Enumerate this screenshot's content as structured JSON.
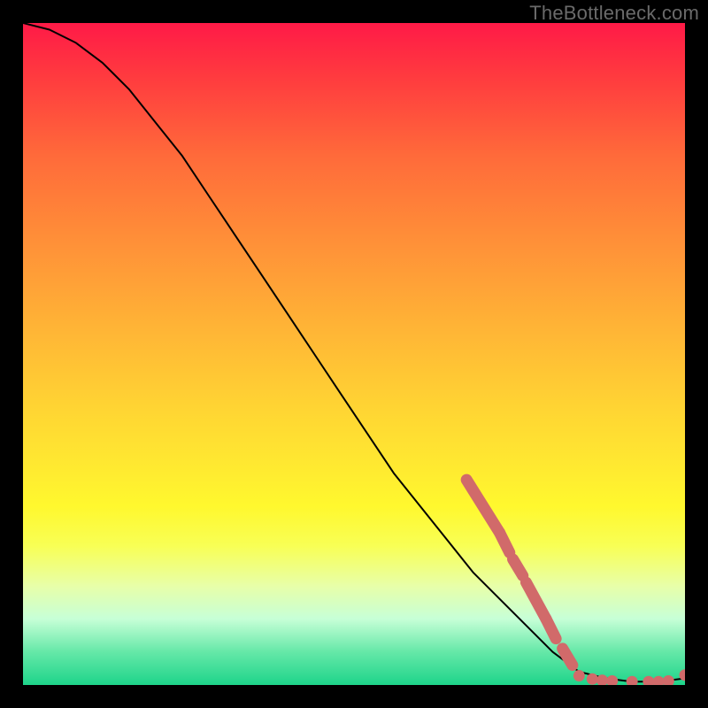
{
  "watermark": "TheBottleneck.com",
  "chart_data": {
    "type": "line",
    "title": "",
    "xlabel": "",
    "ylabel": "",
    "xlim": [
      0,
      100
    ],
    "ylim": [
      0,
      100
    ],
    "series": [
      {
        "name": "curve",
        "x": [
          0,
          4,
          8,
          12,
          16,
          20,
          24,
          28,
          32,
          36,
          40,
          44,
          48,
          52,
          56,
          60,
          64,
          68,
          72,
          76,
          80,
          84,
          88,
          92,
          96,
          100
        ],
        "y": [
          100,
          99,
          97,
          94,
          90,
          85,
          80,
          74,
          68,
          62,
          56,
          50,
          44,
          38,
          32,
          27,
          22,
          17,
          13,
          9,
          5,
          2,
          1,
          0.5,
          0.5,
          1
        ]
      }
    ],
    "markers": {
      "segments": [
        {
          "x1": 67,
          "y1": 31,
          "x2": 72,
          "y2": 23
        },
        {
          "x1": 72,
          "y1": 23,
          "x2": 73.5,
          "y2": 20
        },
        {
          "x1": 74,
          "y1": 19,
          "x2": 75.5,
          "y2": 16.5
        },
        {
          "x1": 76,
          "y1": 15.5,
          "x2": 79,
          "y2": 10
        },
        {
          "x1": 79,
          "y1": 10,
          "x2": 80.5,
          "y2": 7
        },
        {
          "x1": 81.5,
          "y1": 5.5,
          "x2": 83,
          "y2": 3
        }
      ],
      "dots": [
        {
          "x": 84,
          "y": 1.4
        },
        {
          "x": 86,
          "y": 0.9
        },
        {
          "x": 87.5,
          "y": 0.7
        },
        {
          "x": 89,
          "y": 0.6
        },
        {
          "x": 92,
          "y": 0.5
        },
        {
          "x": 94.5,
          "y": 0.5
        },
        {
          "x": 96,
          "y": 0.5
        },
        {
          "x": 97.5,
          "y": 0.6
        },
        {
          "x": 100,
          "y": 1.5
        }
      ]
    },
    "gradient_stops": [
      {
        "pct": 0,
        "color": "#ff1a47"
      },
      {
        "pct": 8,
        "color": "#ff3a3f"
      },
      {
        "pct": 20,
        "color": "#ff6a3a"
      },
      {
        "pct": 32,
        "color": "#ff8d38"
      },
      {
        "pct": 46,
        "color": "#ffb436"
      },
      {
        "pct": 58,
        "color": "#ffd433"
      },
      {
        "pct": 66,
        "color": "#ffe731"
      },
      {
        "pct": 73,
        "color": "#fff82e"
      },
      {
        "pct": 79,
        "color": "#f8ff55"
      },
      {
        "pct": 85,
        "color": "#e8ffa8"
      },
      {
        "pct": 90,
        "color": "#c7ffd7"
      },
      {
        "pct": 95,
        "color": "#65e8a8"
      },
      {
        "pct": 100,
        "color": "#1ed48a"
      }
    ]
  }
}
